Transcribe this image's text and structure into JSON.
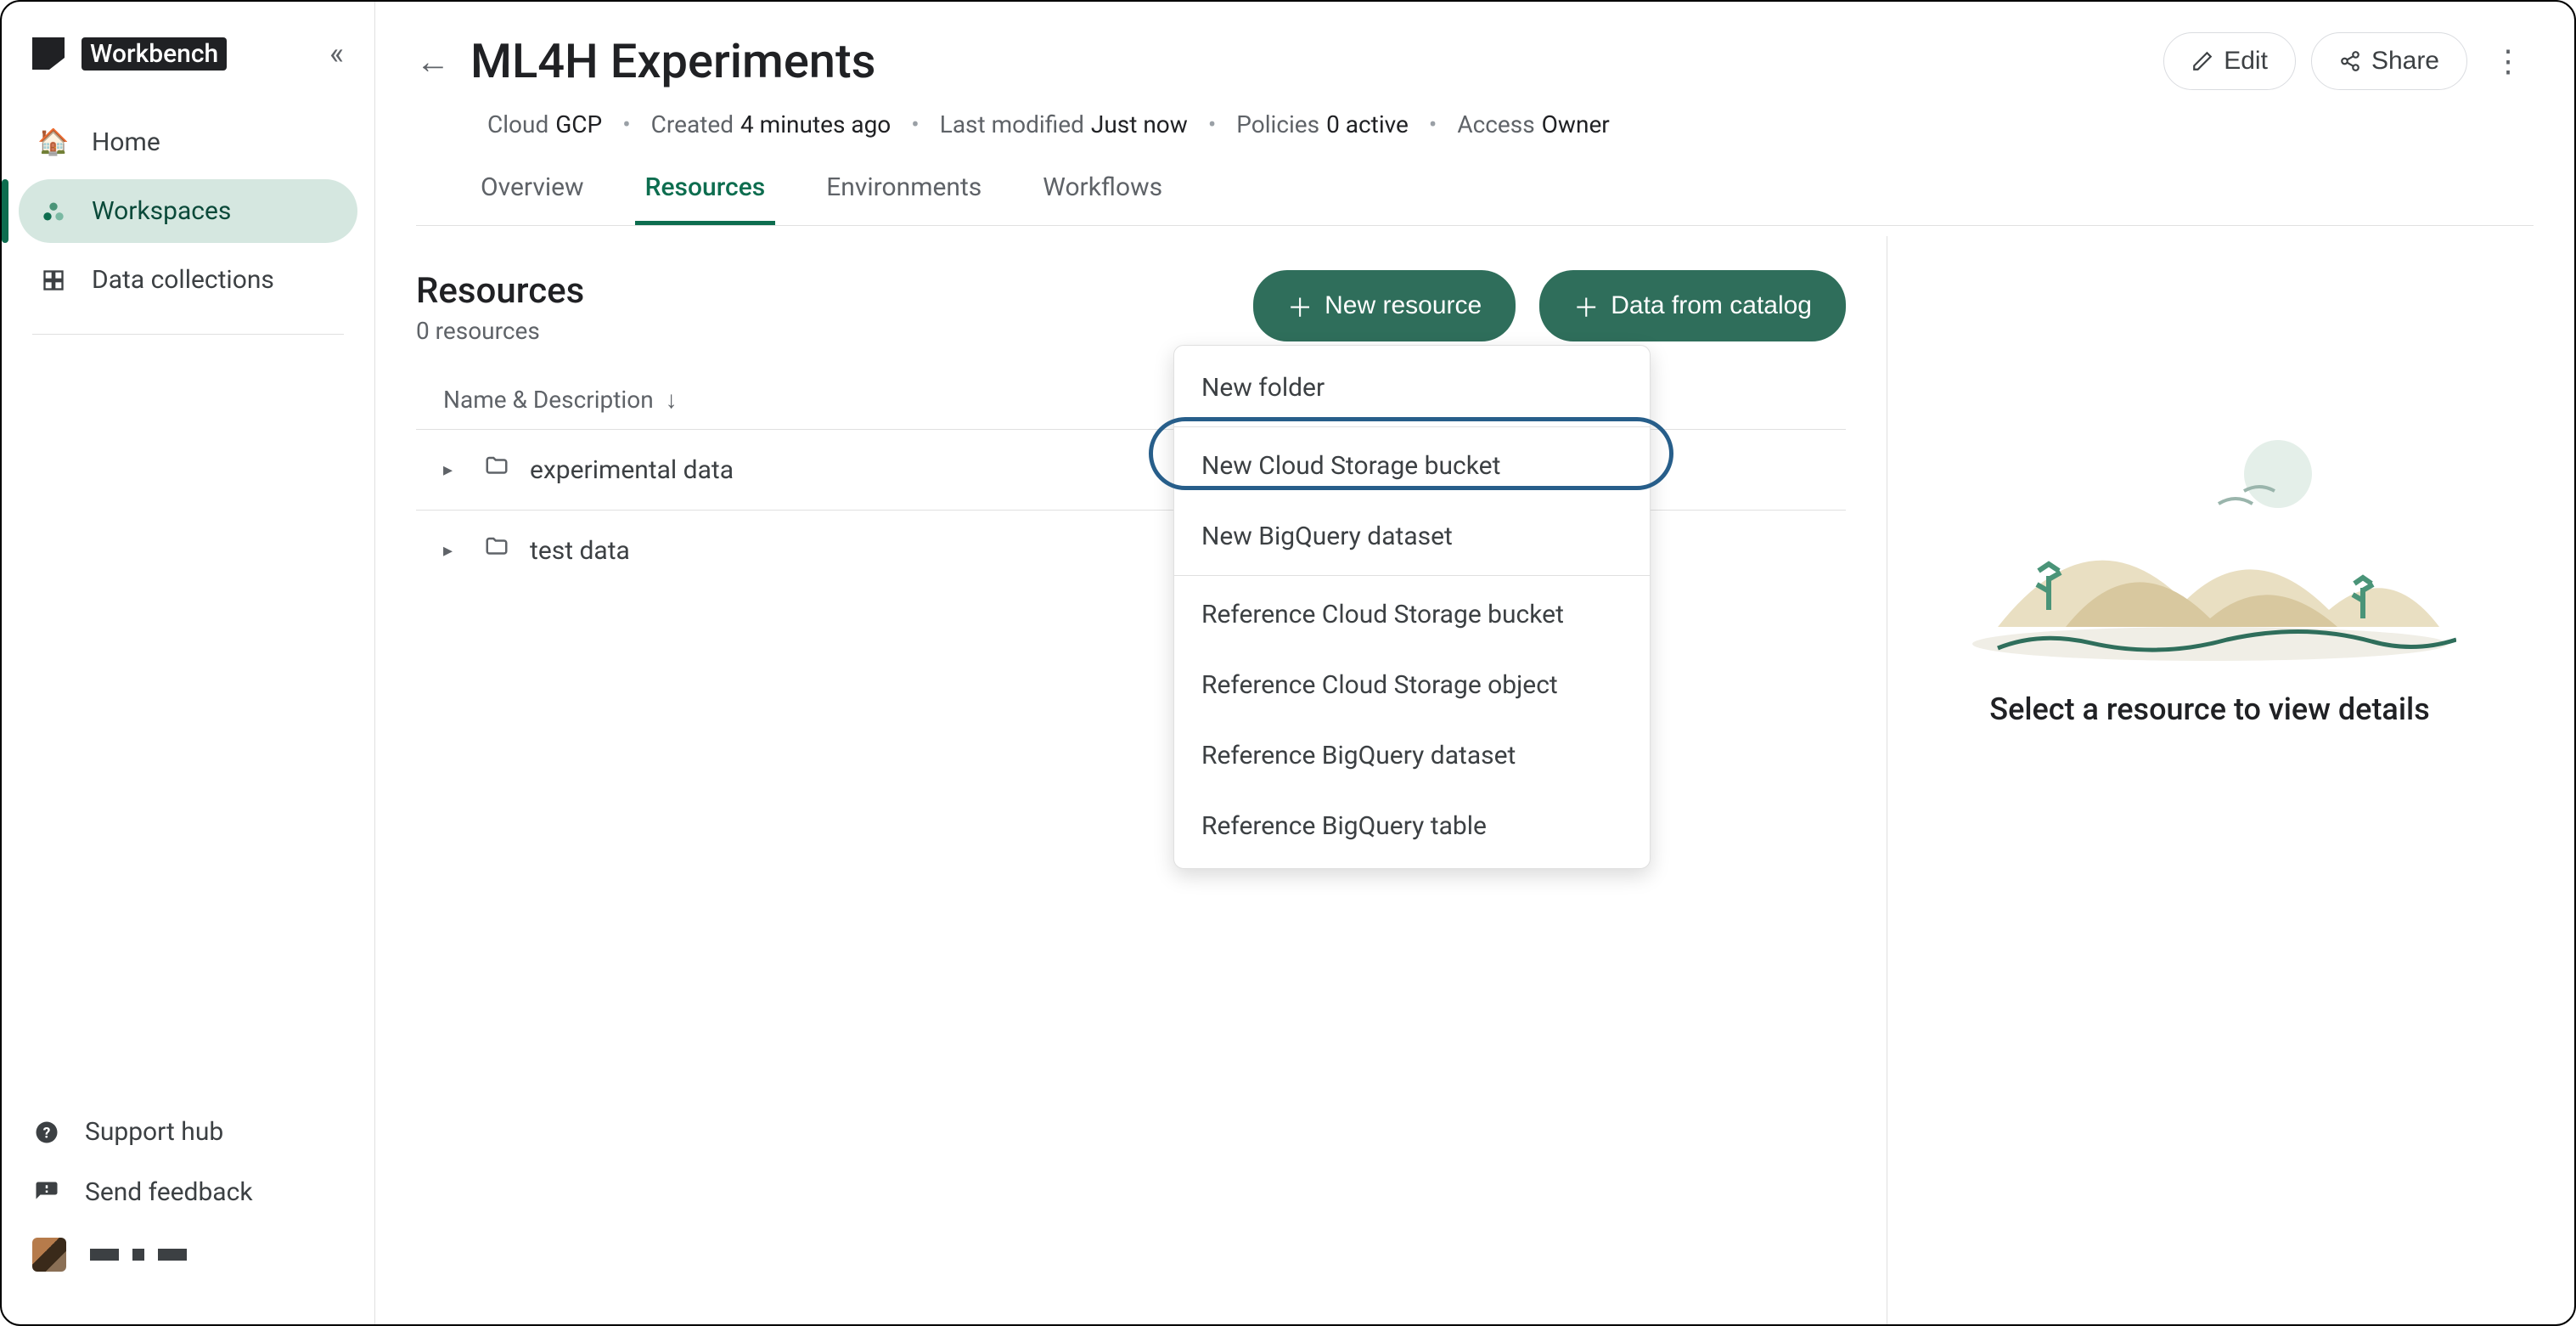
{
  "brand": "Workbench",
  "sidebar": {
    "items": [
      {
        "label": "Home",
        "icon": "🏠"
      },
      {
        "label": "Workspaces",
        "icon": "•"
      },
      {
        "label": "Data collections",
        "icon": "▦"
      }
    ],
    "support": "Support hub",
    "feedback": "Send feedback"
  },
  "header": {
    "title": "ML4H Experiments",
    "edit": "Edit",
    "share": "Share",
    "meta": [
      {
        "label": "Cloud",
        "value": "GCP"
      },
      {
        "label": "Created",
        "value": "4 minutes ago"
      },
      {
        "label": "Last modified",
        "value": "Just now"
      },
      {
        "label": "Policies",
        "value": "0 active"
      },
      {
        "label": "Access",
        "value": "Owner"
      }
    ],
    "tabs": [
      "Overview",
      "Resources",
      "Environments",
      "Workflows"
    ]
  },
  "resources": {
    "title": "Resources",
    "count": "0 resources",
    "new_btn": "New resource",
    "catalog_btn": "Data from catalog",
    "col": "Name & Description",
    "rows": [
      "experimental data",
      "test data"
    ]
  },
  "dropdown": [
    "New folder",
    "New Cloud Storage bucket",
    "New BigQuery dataset",
    "Reference Cloud Storage bucket",
    "Reference Cloud Storage object",
    "Reference BigQuery dataset",
    "Reference BigQuery table"
  ],
  "details": "Select a resource to view details"
}
